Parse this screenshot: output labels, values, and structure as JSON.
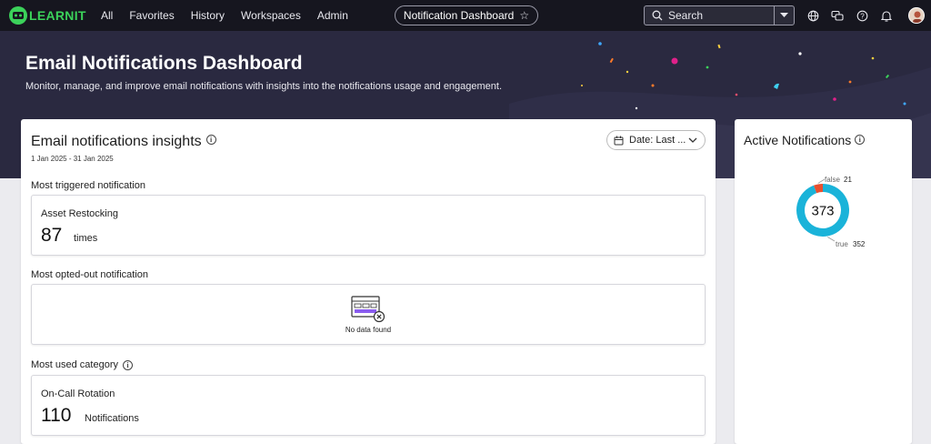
{
  "nav": {
    "logo_text": "LEARNIT",
    "links": [
      "All",
      "Favorites",
      "History",
      "Workspaces",
      "Admin"
    ],
    "center_title": "Notification Dashboard",
    "search_placeholder": "Search"
  },
  "banner": {
    "title": "Email Notifications Dashboard",
    "subtitle": "Monitor, manage, and improve email notifications with insights into the notifications usage and engagement."
  },
  "insights": {
    "title": "Email notifications insights",
    "date_range": "1 Jan 2025 - 31 Jan 2025",
    "date_button": "Date: Last ...",
    "most_triggered": {
      "label": "Most triggered notification",
      "name": "Asset Restocking",
      "count": "87",
      "unit": "times"
    },
    "most_opted_out": {
      "label": "Most opted-out notification",
      "empty_text": "No data found"
    },
    "most_used_category": {
      "label": "Most used category",
      "name": "On-Call Rotation",
      "count": "110",
      "unit": "Notifications"
    }
  },
  "active": {
    "title": "Active Notifications",
    "total": "373",
    "false_label": "false",
    "false_value": "21",
    "true_label": "true",
    "true_value": "352"
  },
  "chart_data": {
    "type": "pie",
    "categories": [
      "false",
      "true"
    ],
    "values": [
      21,
      352
    ],
    "title": "Active Notifications",
    "center_label": "373",
    "colors": [
      "#e8502f",
      "#1ab3d9"
    ]
  },
  "colors": {
    "nav_bg": "#16161f",
    "banner_bg": "#2a2940",
    "brand_green": "#3bd15a",
    "donut_true": "#1ab3d9",
    "donut_false": "#e8502f"
  }
}
